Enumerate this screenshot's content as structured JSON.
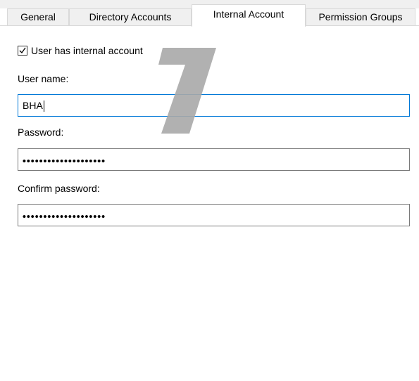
{
  "tabs": [
    {
      "label": "General",
      "selected": false
    },
    {
      "label": "Directory Accounts",
      "selected": false
    },
    {
      "label": "Internal Account",
      "selected": true
    },
    {
      "label": "Permission Groups",
      "selected": false
    }
  ],
  "form": {
    "checkbox_label": "User has internal account",
    "checkbox_checked": true,
    "username_label": "User name:",
    "username_value": "BHA",
    "password_label": "Password:",
    "password_value": "••••••••••••••••••••",
    "confirm_label": "Confirm password:",
    "confirm_value": "••••••••••••••••••••"
  },
  "watermark": {
    "text": "7",
    "color": "#a8a8a8"
  },
  "colors": {
    "focus_border": "#0078d7",
    "tab_background": "#f0f0f0"
  }
}
